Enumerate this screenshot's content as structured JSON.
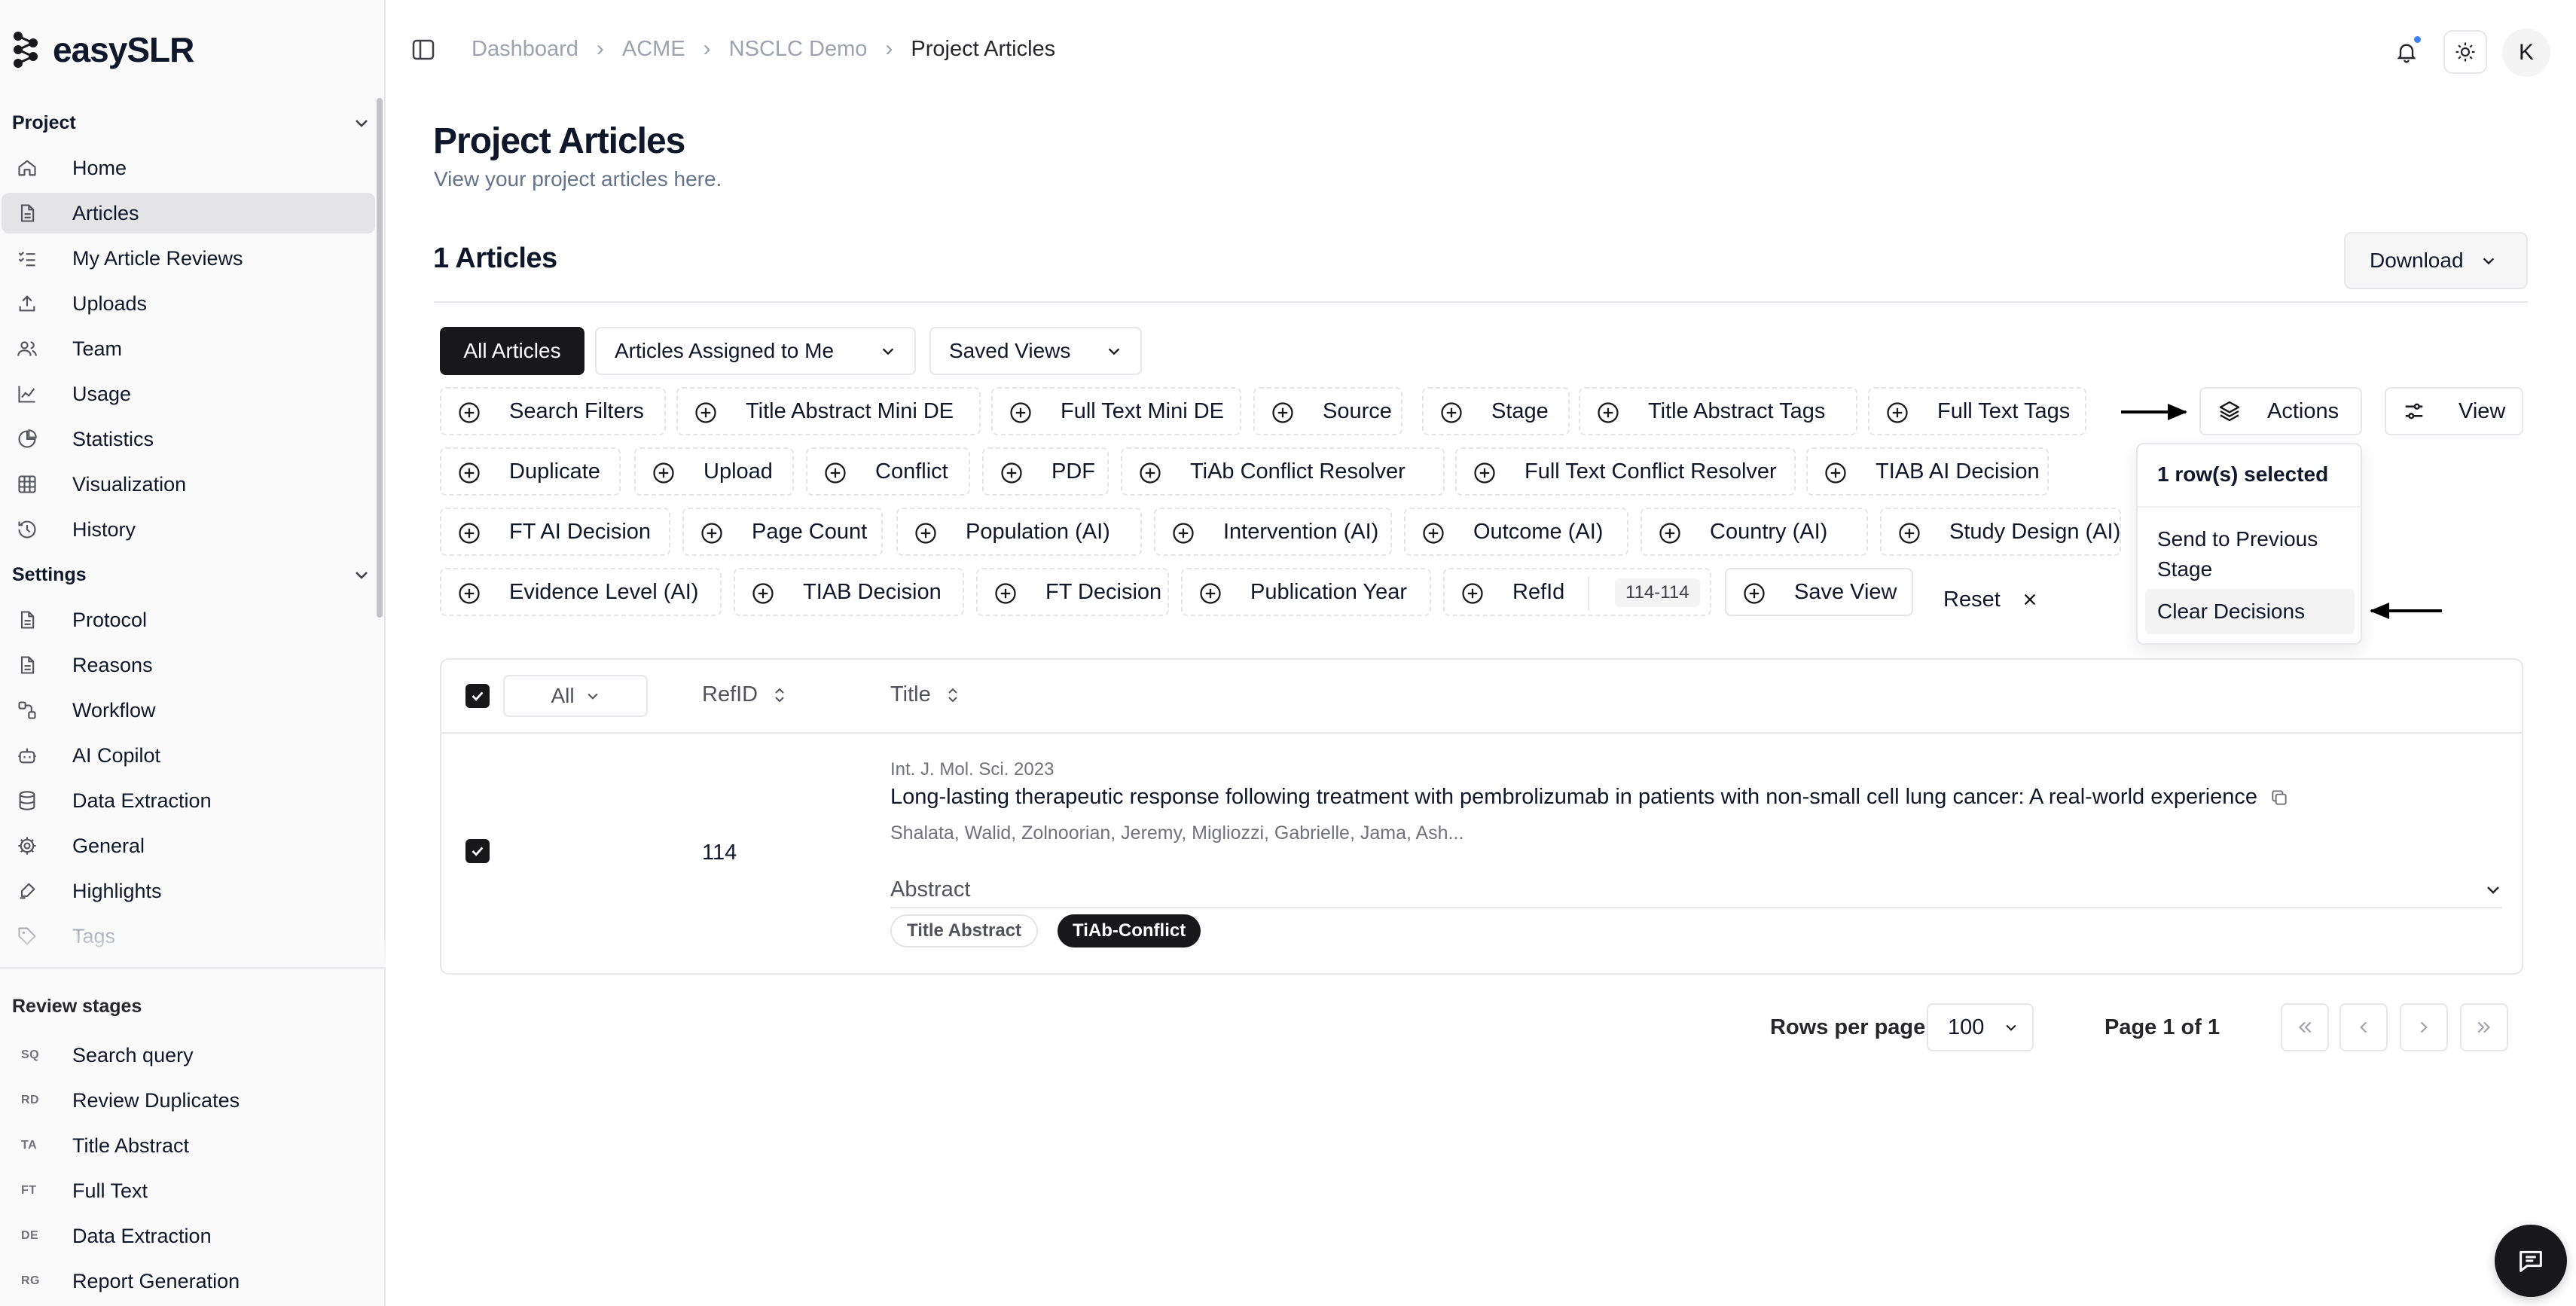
{
  "brand": {
    "logo_text": "easySLR"
  },
  "sidebar": {
    "project_section": "Project",
    "project_items": [
      {
        "label": "Home",
        "icon": "home-icon"
      },
      {
        "label": "Articles",
        "icon": "document-icon",
        "active": true
      },
      {
        "label": "My Article Reviews",
        "icon": "list-check-icon"
      },
      {
        "label": "Uploads",
        "icon": "upload-icon"
      },
      {
        "label": "Team",
        "icon": "users-icon"
      },
      {
        "label": "Usage",
        "icon": "line-chart-icon"
      },
      {
        "label": "Statistics",
        "icon": "pie-icon"
      },
      {
        "label": "Visualization",
        "icon": "grid-icon"
      },
      {
        "label": "History",
        "icon": "history-icon"
      }
    ],
    "settings_section": "Settings",
    "settings_items": [
      {
        "label": "Protocol",
        "icon": "document-icon"
      },
      {
        "label": "Reasons",
        "icon": "document-icon"
      },
      {
        "label": "Workflow",
        "icon": "workflow-icon"
      },
      {
        "label": "AI Copilot",
        "icon": "bot-icon"
      },
      {
        "label": "Data Extraction",
        "icon": "database-icon"
      },
      {
        "label": "General",
        "icon": "gear-icon"
      },
      {
        "label": "Highlights",
        "icon": "highlighter-icon"
      },
      {
        "label": "Tags",
        "icon": "tag-icon"
      }
    ],
    "stages_section": "Review stages",
    "stages": [
      {
        "abbr": "SQ",
        "label": "Search query"
      },
      {
        "abbr": "RD",
        "label": "Review Duplicates"
      },
      {
        "abbr": "TA",
        "label": "Title Abstract"
      },
      {
        "abbr": "FT",
        "label": "Full Text"
      },
      {
        "abbr": "DE",
        "label": "Data Extraction"
      },
      {
        "abbr": "RG",
        "label": "Report Generation"
      }
    ]
  },
  "header": {
    "breadcrumbs": [
      "Dashboard",
      "ACME",
      "NSCLC Demo",
      "Project Articles"
    ],
    "avatar_initial": "K",
    "notification_color": "#3b82f6"
  },
  "main": {
    "title": "Project Articles",
    "subtitle": "View your project articles here.",
    "count_label": "1 Articles",
    "download_label": "Download",
    "view_tabs": [
      "All Articles",
      "Articles Assigned to Me",
      "Saved Views"
    ],
    "filter_chips": [
      "Search Filters",
      "Title Abstract Mini DE",
      "Full Text Mini DE",
      "Source",
      "Stage",
      "Title Abstract Tags",
      "Full Text Tags",
      "Duplicate",
      "Upload",
      "Conflict",
      "PDF",
      "TiAb Conflict Resolver",
      "Full Text Conflict Resolver",
      "TIAB AI Decision",
      "FT AI Decision",
      "Page Count",
      "Population (AI)",
      "Intervention (AI)",
      "Outcome (AI)",
      "Country (AI)",
      "Study Design (AI)",
      "Evidence Level (AI)",
      "TIAB Decision",
      "FT Decision",
      "Publication Year",
      "RefId",
      "Save View"
    ],
    "refid_range": "114-114",
    "reset_label": "Reset",
    "actions_label": "Actions",
    "view_label": "View",
    "actions_menu": {
      "header": "1 row(s) selected",
      "items": [
        "Send to Previous Stage",
        "Clear Decisions"
      ]
    }
  },
  "table": {
    "all_select": "All",
    "columns": [
      "RefID",
      "Title"
    ],
    "rows": [
      {
        "refid": "114",
        "journal": "Int. J. Mol. Sci. 2023",
        "title": "Long-lasting therapeutic response following treatment with pembrolizumab in patients with non-small cell lung cancer: A real-world experience",
        "authors": "Shalata, Walid, Zolnoorian, Jeremy, Migliozzi, Gabrielle, Jama, Ash...",
        "abstract_label": "Abstract",
        "tags": [
          "Title Abstract",
          "TiAb-Conflict"
        ],
        "selected": true
      }
    ]
  },
  "pagination": {
    "rows_per_page_label": "Rows per page",
    "rows_per_page": "100",
    "page_label": "Page 1 of 1"
  }
}
